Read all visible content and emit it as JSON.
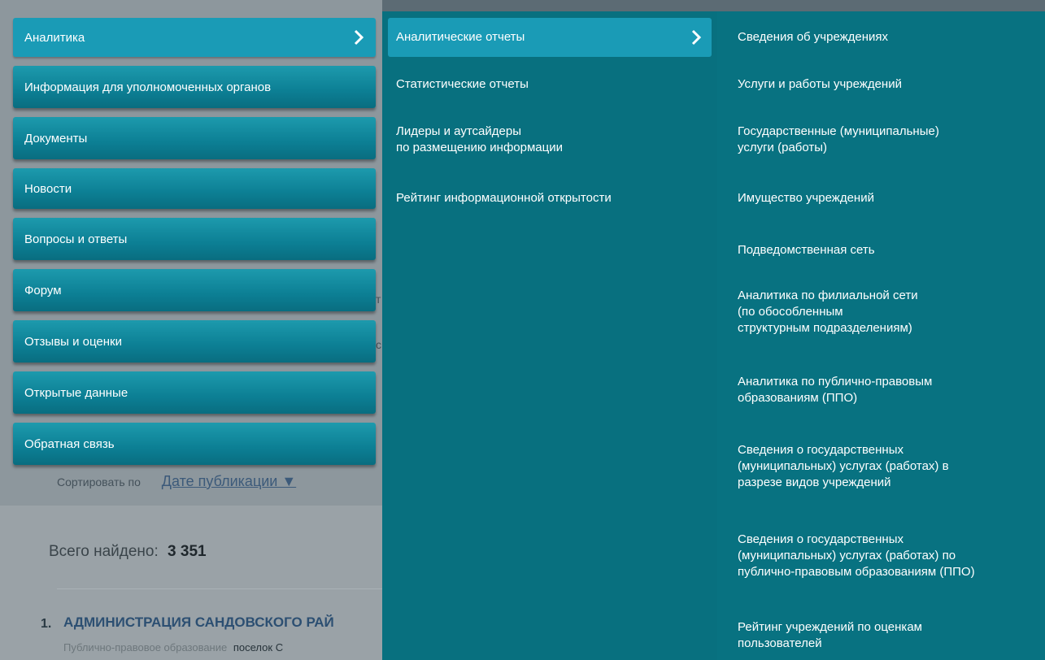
{
  "nav_left": {
    "items": [
      {
        "label": "Аналитика"
      },
      {
        "label": "Информация для уполномоченных органов"
      },
      {
        "label": "Документы"
      },
      {
        "label": "Новости"
      },
      {
        "label": "Вопросы и ответы"
      },
      {
        "label": "Форум"
      },
      {
        "label": "Отзывы и оценки"
      },
      {
        "label": "Открытые данные"
      },
      {
        "label": "Обратная связь"
      }
    ]
  },
  "nav_mid": {
    "items": [
      {
        "label": "Аналитические отчеты"
      },
      {
        "label": "Статистические отчеты"
      },
      {
        "label_line1": "Лидеры и аутсайдеры",
        "label_line2": "по размещению информации"
      },
      {
        "label": "Рейтинг информационной открытости"
      }
    ]
  },
  "nav_right": {
    "items": [
      {
        "lines": [
          "Сведения об учреждениях"
        ]
      },
      {
        "lines": [
          "Услуги и работы учреждений"
        ]
      },
      {
        "lines": [
          "Государственные (муниципальные)",
          "услуги (работы)"
        ]
      },
      {
        "lines": [
          "Имущество учреждений"
        ]
      },
      {
        "lines": [
          "Подведомственная сеть"
        ]
      },
      {
        "lines": [
          "Аналитика по филиальной сети",
          "(по обособленным",
          "структурным подразделениям)"
        ]
      },
      {
        "lines": [
          "Аналитика по публично-правовым",
          "образованиям (ППО)"
        ]
      },
      {
        "lines": [
          "Сведения о государственных",
          "(муниципальных) услугах (работах) в",
          "разрезе видов учреждений"
        ]
      },
      {
        "lines": [
          "Сведения о государственных",
          "(муниципальных) услугах (работах) по",
          "публично-правовым образованиям (ППО)"
        ]
      },
      {
        "lines": [
          "Рейтинг учреждений по оценкам",
          "пользователей"
        ]
      }
    ]
  },
  "background_page": {
    "sort_label": "Сортировать по",
    "sort_value": "Дате публикации ▼",
    "found_label": "Всего найдено:",
    "found_count": "3 351",
    "result_number": "1.",
    "result_title": "АДМИНИСТРАЦИЯ САНДОВСКОГО РАЙ",
    "result_sub_label": "Публично-правовое образование",
    "result_sub_value": "поселок С",
    "peek_1": "т",
    "peek_2": "с"
  },
  "colors": {
    "menu_item": "#0c7f94",
    "menu_active": "#1a9bb6",
    "panel_bg": "#08707f",
    "text": "#ffffff"
  },
  "icons": {
    "chevron": "chevron-right-icon"
  }
}
